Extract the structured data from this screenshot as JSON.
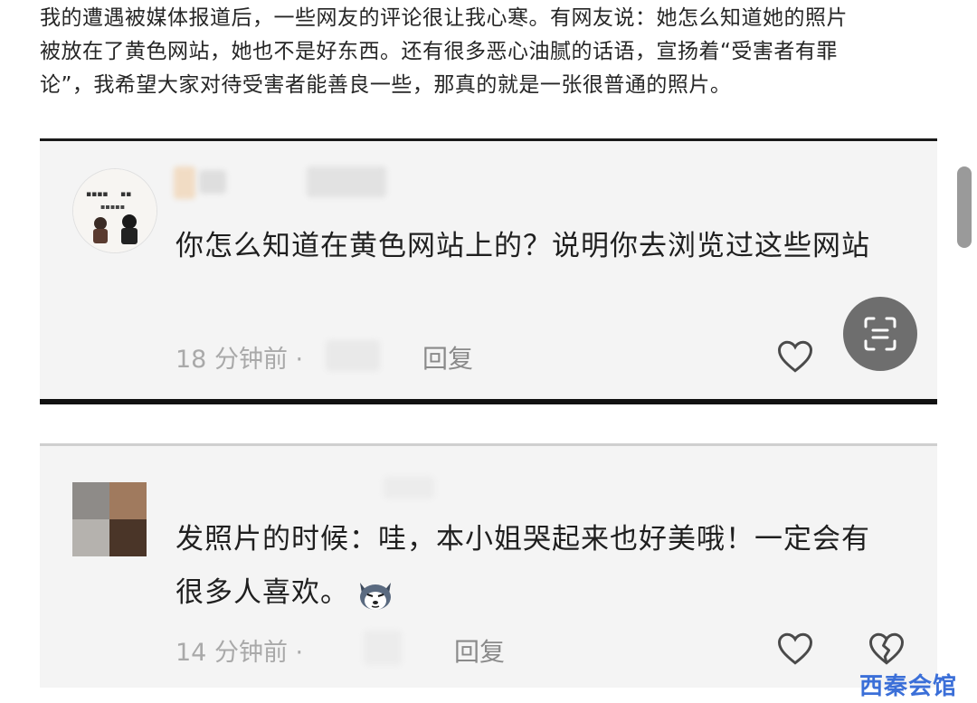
{
  "article": {
    "lines": [
      "我的遭遇被媒体报道后，一些网友的评论很让我心寒。有网友说：她怎么知道她的照片",
      "被放在了黄色网站，她也不是好东西。还有很多恶心油腻的话语，宣扬着“受害者有罪",
      "论”，我希望大家对待受害者能善良一些，那真的就是一张很普通的照片。"
    ]
  },
  "comments": [
    {
      "text": "你怎么知道在黄色网站上的？说明你去浏览过这些网站",
      "time": "18 分钟前 ·",
      "reply_label": "回复"
    },
    {
      "text": "发照片的时候：哇，本小姐哭起来也好美哦！一定会有很多人喜欢。",
      "time": "14 分钟前 ·",
      "reply_label": "回复"
    }
  ],
  "watermark": "西秦会馆",
  "icons": {
    "like": "heart-outline-icon",
    "dislike": "broken-heart-icon",
    "scan": "scan-text-icon",
    "emoji": "husky-dog-emoji-icon"
  },
  "colors": {
    "card_bg": "#f4f4f4",
    "meta_text": "#a9a9a9",
    "watermark": "#3b6fd8"
  }
}
